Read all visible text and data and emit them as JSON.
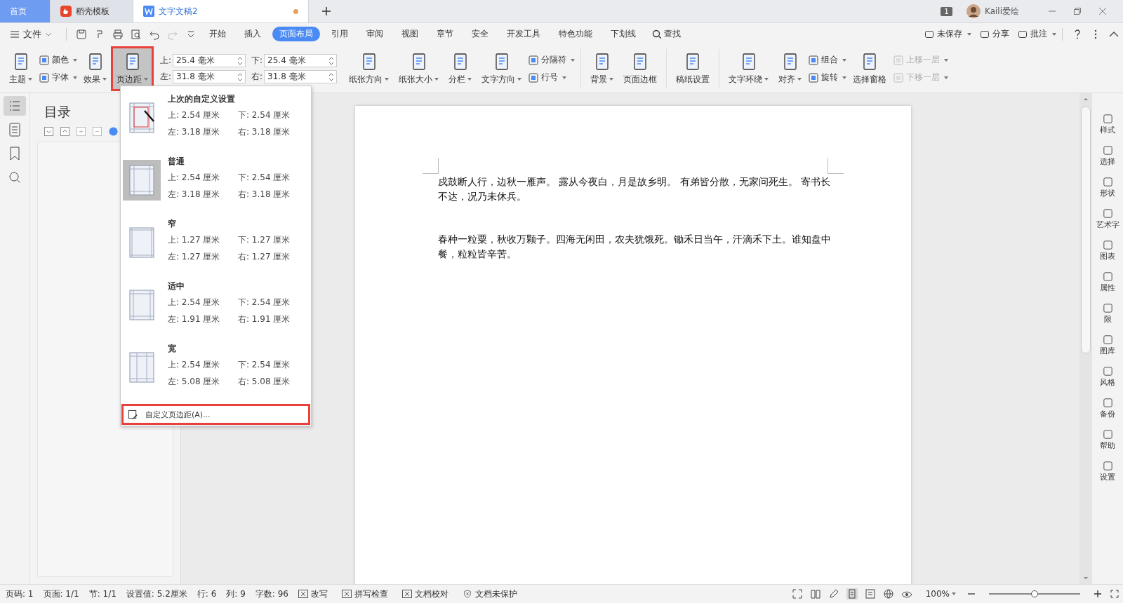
{
  "tabs": [
    {
      "label": "首页",
      "kind": "home",
      "selected": false
    },
    {
      "label": "稻壳模板",
      "kind": "template",
      "selected": false
    },
    {
      "label": "文字文稿2",
      "kind": "doc",
      "selected": true,
      "unsaved": true
    }
  ],
  "title_bar": {
    "window_count": "1",
    "user": "Kaili爱绘"
  },
  "menu": {
    "file": "文件",
    "tabs": [
      {
        "label": "开始",
        "selected": false
      },
      {
        "label": "插入",
        "selected": false
      },
      {
        "label": "页面布局",
        "selected": true
      },
      {
        "label": "引用",
        "selected": false
      },
      {
        "label": "审阅",
        "selected": false
      },
      {
        "label": "视图",
        "selected": false
      },
      {
        "label": "章节",
        "selected": false
      },
      {
        "label": "安全",
        "selected": false
      },
      {
        "label": "开发工具",
        "selected": false
      },
      {
        "label": "特色功能",
        "selected": false
      },
      {
        "label": "下划线",
        "selected": false
      }
    ],
    "search": "查找",
    "right": [
      {
        "label": "未保存",
        "caret": true
      },
      {
        "label": "分享",
        "caret": false
      },
      {
        "label": "批注",
        "caret": true
      }
    ]
  },
  "ribbon": [
    {
      "kind": "large",
      "label": "主题",
      "caret": true,
      "expanded": false,
      "disabled": false
    },
    {
      "kind": "stack",
      "items": [
        {
          "label": "颜色",
          "caret": true,
          "disabled": false
        },
        {
          "label": "字体",
          "caret": true,
          "disabled": false
        }
      ]
    },
    {
      "kind": "large",
      "label": "效果",
      "caret": true,
      "expanded": false,
      "disabled": false
    },
    {
      "kind": "large",
      "label": "页边距",
      "caret": true,
      "expanded": true,
      "disabled": false
    },
    {
      "kind": "margins",
      "fields": [
        {
          "label": "上:",
          "value": "25.4 毫米"
        },
        {
          "label": "下:",
          "value": "25.4 毫米"
        },
        {
          "label": "左:",
          "value": "31.8 毫米"
        },
        {
          "label": "右:",
          "value": "31.8 毫米"
        }
      ]
    },
    {
      "kind": "large",
      "label": "纸张方向",
      "caret": true,
      "expanded": false,
      "disabled": false
    },
    {
      "kind": "large",
      "label": "纸张大小",
      "caret": true,
      "expanded": false,
      "disabled": false
    },
    {
      "kind": "large",
      "label": "分栏",
      "caret": true,
      "expanded": false,
      "disabled": false
    },
    {
      "kind": "large",
      "label": "文字方向",
      "caret": true,
      "expanded": false,
      "disabled": false
    },
    {
      "kind": "stack",
      "items": [
        {
          "label": "分隔符",
          "caret": true,
          "disabled": false
        },
        {
          "label": "行号",
          "caret": true,
          "disabled": false
        }
      ]
    },
    {
      "kind": "divider"
    },
    {
      "kind": "large",
      "label": "背景",
      "caret": true,
      "expanded": false,
      "disabled": false
    },
    {
      "kind": "large",
      "label": "页面边框",
      "caret": false,
      "expanded": false,
      "disabled": false
    },
    {
      "kind": "divider"
    },
    {
      "kind": "large",
      "label": "稿纸设置",
      "caret": false,
      "expanded": false,
      "disabled": false
    },
    {
      "kind": "divider"
    },
    {
      "kind": "large",
      "label": "文字环绕",
      "caret": true,
      "expanded": false,
      "disabled": false
    },
    {
      "kind": "large",
      "label": "对齐",
      "caret": true,
      "expanded": false,
      "disabled": false
    },
    {
      "kind": "stack",
      "items": [
        {
          "label": "组合",
          "caret": true,
          "disabled": false
        },
        {
          "label": "旋转",
          "caret": true,
          "disabled": false
        }
      ]
    },
    {
      "kind": "large",
      "label": "选择窗格",
      "caret": false,
      "expanded": false,
      "disabled": false
    },
    {
      "kind": "stack",
      "items": [
        {
          "label": "上移一层",
          "caret": true,
          "disabled": true
        },
        {
          "label": "下移一层",
          "caret": true,
          "disabled": true
        }
      ]
    }
  ],
  "margin_menu": {
    "presets": [
      {
        "title": "上次的自定义设置",
        "kind": "custom",
        "selected": false,
        "values": [
          "上: 2.54 厘米",
          "下: 2.54 厘米",
          "左: 3.18 厘米",
          "右: 3.18 厘米"
        ]
      },
      {
        "title": "普通",
        "kind": "normal",
        "selected": true,
        "values": [
          "上: 2.54 厘米",
          "下: 2.54 厘米",
          "左: 3.18 厘米",
          "右: 3.18 厘米"
        ]
      },
      {
        "title": "窄",
        "kind": "narrow",
        "selected": false,
        "values": [
          "上: 1.27 厘米",
          "下: 1.27 厘米",
          "左: 1.27 厘米",
          "右: 1.27 厘米"
        ]
      },
      {
        "title": "适中",
        "kind": "moderate",
        "selected": false,
        "values": [
          "上: 2.54 厘米",
          "下: 2.54 厘米",
          "左: 1.91 厘米",
          "右: 1.91 厘米"
        ]
      },
      {
        "title": "宽",
        "kind": "wide",
        "selected": false,
        "values": [
          "上: 2.54 厘米",
          "下: 2.54 厘米",
          "左: 5.08 厘米",
          "右: 5.08 厘米"
        ]
      }
    ],
    "custom": "自定义页边距(A)..."
  },
  "nav_panel": {
    "title": "目录"
  },
  "document": {
    "paragraphs": [
      "戍鼓断人行，边秋一雁声。 露从今夜白，月是故乡明。 有弟皆分散，无家问死生。 寄书长不达，况乃未休兵。",
      "春种一粒粟，秋收万颗子。四海无闲田，农夫犹饿死。锄禾日当午，汗滴禾下土。谁知盘中餐，粒粒皆辛苦。"
    ]
  },
  "side_tools": [
    "样式",
    "选择",
    "形状",
    "艺术字",
    "图表",
    "属性",
    "限",
    "图库",
    "风格",
    "备份",
    "帮助",
    "设置"
  ],
  "status_bar": {
    "items": [
      "页码: 1",
      "页面: 1/1",
      "节: 1/1",
      "设置值: 5.2厘米",
      "行: 6",
      "列: 9",
      "字数: 96"
    ],
    "toggles": [
      "改写",
      "拼写检查",
      "文档校对"
    ],
    "protect": "文档未保护",
    "zoom": "100%",
    "zoom_slider": {
      "level": 0.5
    }
  }
}
